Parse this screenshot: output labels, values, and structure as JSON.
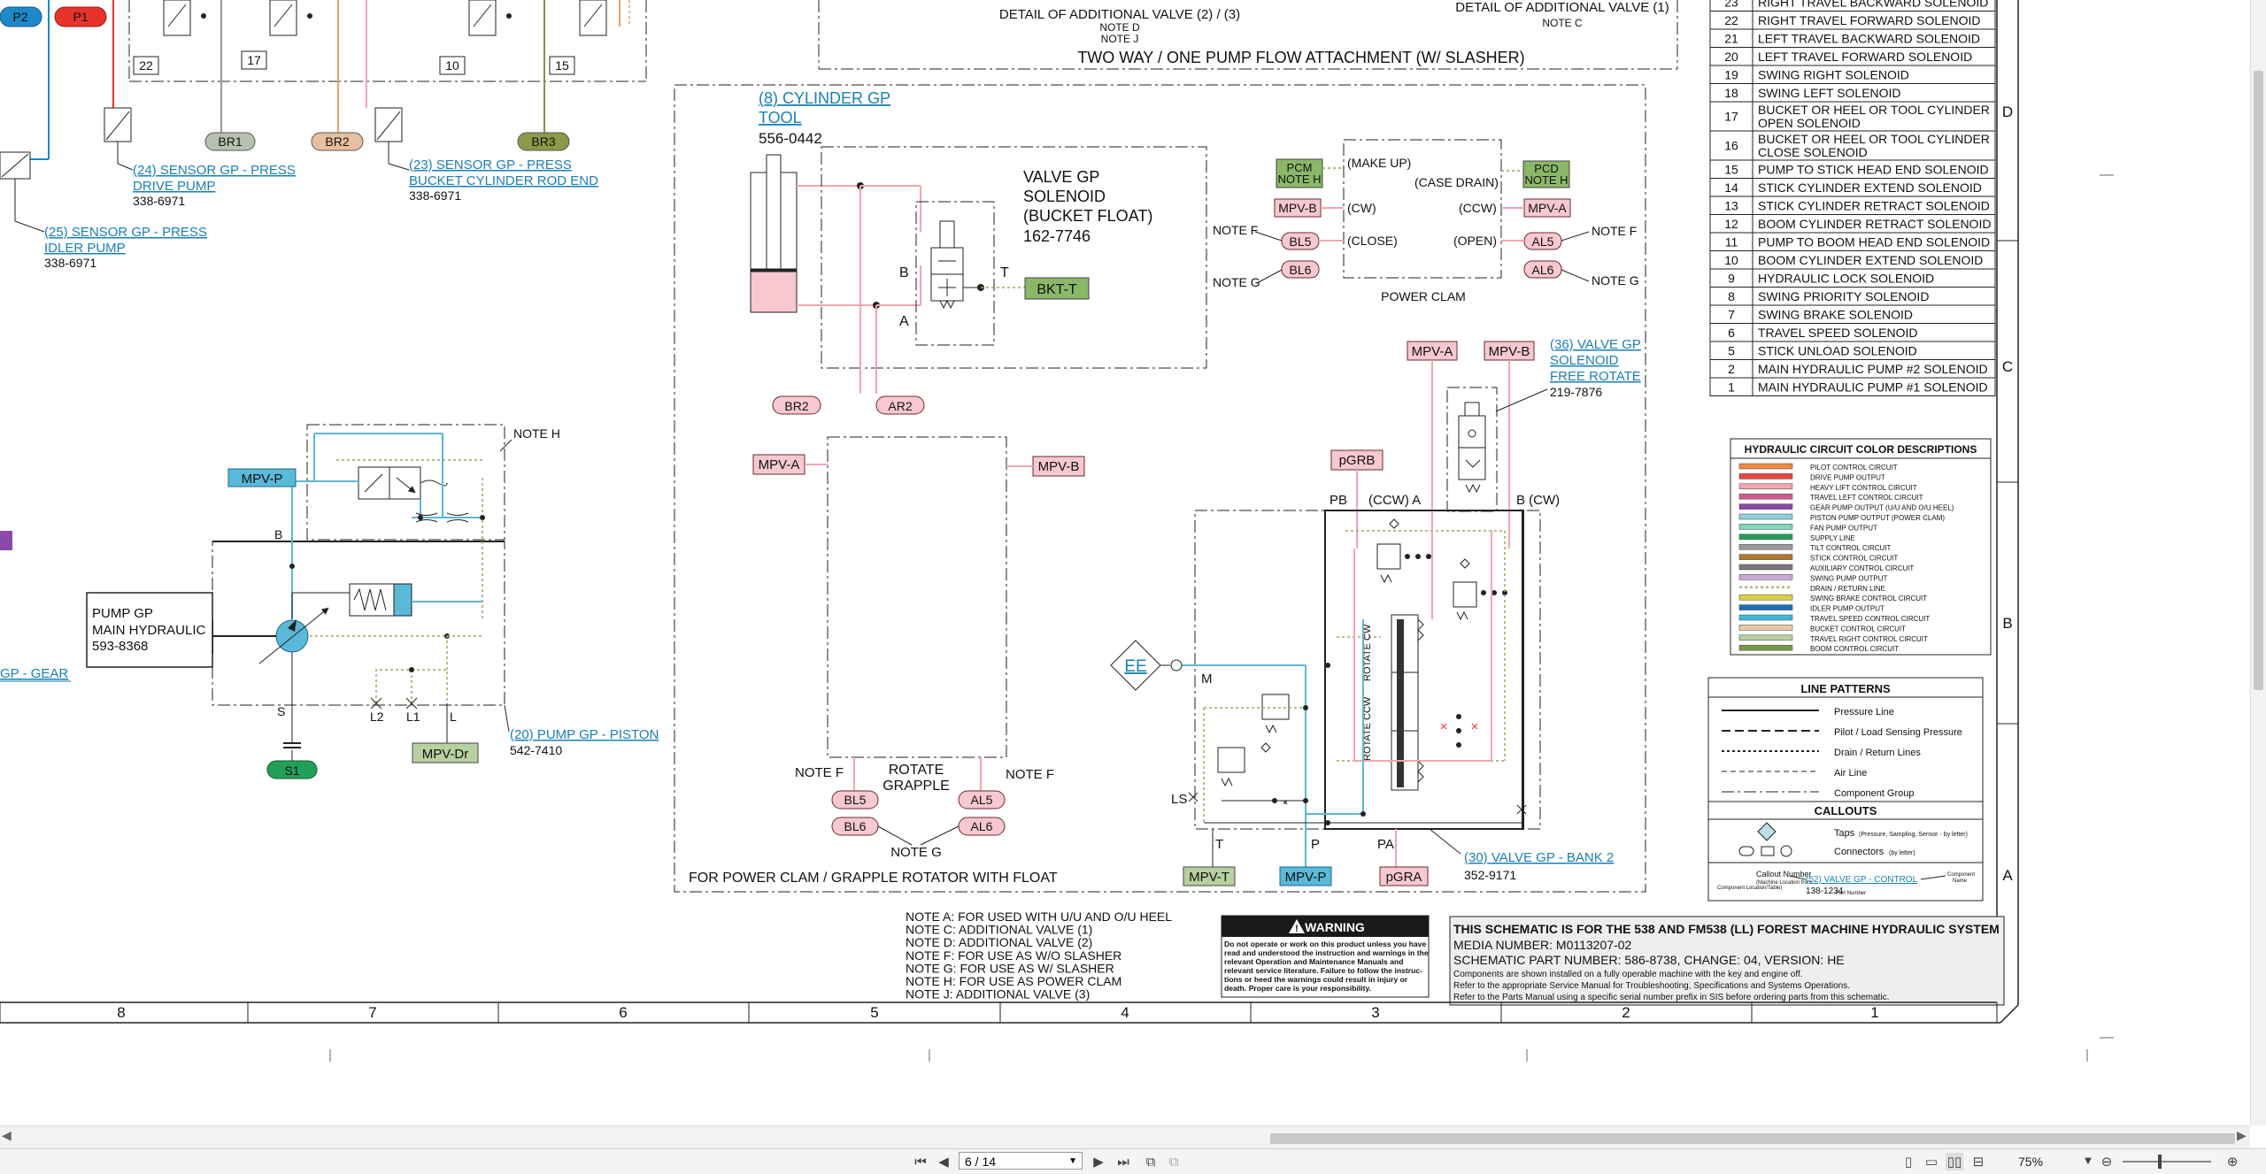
{
  "viewer": {
    "page_display": "6 / 14",
    "zoom": "75%",
    "nav": {
      "first": "⏮",
      "prev": "◀",
      "next": "▶",
      "last": "⏭"
    }
  },
  "top": {
    "p2": "P2",
    "p1": "P1",
    "detail_left": "DETAIL OF ADDITIONAL VALVE (2) / (3)",
    "detail_left_notes": [
      "NOTE D",
      "NOTE J"
    ],
    "detail_right": "DETAIL OF ADDITIONAL VALVE (1)",
    "detail_right_note": "NOTE C",
    "two_way_title": "TWO WAY / ONE PUMP FLOW  ATTACHMENT (W/ SLASHER)",
    "box_numbers": [
      "22",
      "17",
      "10",
      "15"
    ],
    "br_tags": [
      "BR1",
      "BR2",
      "BR3"
    ]
  },
  "sensors": [
    {
      "label": "(24) SENSOR GP - PRESS",
      "label2": "DRIVE PUMP",
      "part": "338-6971"
    },
    {
      "label": "(23) SENSOR GP - PRESS",
      "label2": "BUCKET CYLINDER ROD END",
      "part": "338-6971"
    },
    {
      "label": "(25) SENSOR GP - PRESS",
      "label2": "IDLER PUMP",
      "part": "338-6971"
    }
  ],
  "pump": {
    "title1": "PUMP GP",
    "title2": "MAIN HYDRAULIC",
    "part": "593-8368",
    "mpv_p": "MPV-P",
    "note_h": "NOTE H",
    "b": "B",
    "s": "S",
    "s1": "S1",
    "l2": "L2",
    "l1": "L1",
    "l": "L",
    "mpv_dr": "MPV-Dr",
    "piston_link": "(20) PUMP GP - PISTON",
    "piston_part": "542-7410",
    "gear_link": "GP - GEAR"
  },
  "attachment": {
    "cyl_link1": "(8) CYLINDER GP",
    "cyl_link2": "TOOL",
    "cyl_part": "556-0442",
    "valve1": "VALVE GP",
    "valve2": "SOLENOID",
    "valve3": "(BUCKET FLOAT)",
    "valve_part": "162-7746",
    "b": "B",
    "a": "A",
    "t": "T",
    "bkt": "BKT-T",
    "br2": "BR2",
    "ar2": "AR2",
    "mpv_a": "MPV-A",
    "mpv_b": "MPV-B",
    "rotate": "ROTATE",
    "grapple": "GRAPPLE",
    "note_f": "NOTE F",
    "note_g": "NOTE G",
    "bl5": "BL5",
    "bl6": "BL6",
    "al5": "AL5",
    "al6": "AL6",
    "footer": "FOR POWER CLAM / GRAPPLE ROTATOR WITH FLOAT"
  },
  "power_clam": {
    "pcm": "PCM",
    "pcm_note": "NOTE H",
    "pcd": "PCD",
    "pcd_note": "NOTE H",
    "make_up": "(MAKE UP)",
    "case_drain": "(CASE DRAIN)",
    "cw": "(CW)",
    "ccw": "(CCW)",
    "close": "(CLOSE)",
    "open": "(OPEN)",
    "mpv_b": "MPV-B",
    "mpv_a": "MPV-A",
    "bl5": "BL5",
    "bl6": "BL6",
    "al5": "AL5",
    "al6": "AL6",
    "note_f": "NOTE F",
    "note_g": "NOTE G",
    "title": "POWER CLAM"
  },
  "rotate_valve": {
    "mpv_a": "MPV-A",
    "mpv_b": "MPV-B",
    "link1": "(36) VALVE GP",
    "link2": "SOLENOID",
    "link3": "FREE ROTATE",
    "part": "219-7876",
    "pgrb": "pGRB",
    "pb": "PB",
    "ccw_a": "(CCW) A",
    "b_cw": "B (CW)",
    "ee": "EE",
    "m": "M",
    "ls": "LS",
    "t": "T",
    "p": "P",
    "pa": "PA",
    "rotate_cw": "ROTATE CW",
    "rotate_ccw": "ROTATE CCW",
    "mpv_t": "MPV-T",
    "mpv_p": "MPV-P",
    "pgra": "pGRA",
    "bank_link": "(30) VALVE GP - BANK 2",
    "bank_part": "352-9171"
  },
  "solenoids": [
    {
      "n": "23",
      "d": "RIGHT TRAVEL BACKWARD SOLENOID"
    },
    {
      "n": "22",
      "d": "RIGHT TRAVEL FORWARD SOLENOID"
    },
    {
      "n": "21",
      "d": "LEFT TRAVEL BACKWARD SOLENOID"
    },
    {
      "n": "20",
      "d": "LEFT TRAVEL FORWARD SOLENOID"
    },
    {
      "n": "19",
      "d": "SWING RIGHT SOLENOID"
    },
    {
      "n": "18",
      "d": "SWING LEFT SOLENOID"
    },
    {
      "n": "17",
      "d": "BUCKET OR HEEL OR TOOL CYLINDER",
      "d2": "OPEN SOLENOID"
    },
    {
      "n": "16",
      "d": "BUCKET OR HEEL OR TOOL CYLINDER",
      "d2": "CLOSE SOLENOID"
    },
    {
      "n": "15",
      "d": "PUMP TO STICK HEAD END SOLENOID"
    },
    {
      "n": "14",
      "d": "STICK CYLINDER EXTEND SOLENOID"
    },
    {
      "n": "13",
      "d": "STICK CYLINDER RETRACT SOLENOID"
    },
    {
      "n": "12",
      "d": "BOOM CYLINDER RETRACT SOLENOID"
    },
    {
      "n": "11",
      "d": "PUMP TO BOOM HEAD END SOLENOID"
    },
    {
      "n": "10",
      "d": "BOOM CYLINDER EXTEND SOLENOID"
    },
    {
      "n": "9",
      "d": "HYDRAULIC LOCK SOLENOID"
    },
    {
      "n": "8",
      "d": "SWING PRIORITY SOLENOID"
    },
    {
      "n": "7",
      "d": "SWING BRAKE SOLENOID"
    },
    {
      "n": "6",
      "d": "TRAVEL SPEED SOLENOID"
    },
    {
      "n": "5",
      "d": "STICK UNLOAD SOLENOID"
    },
    {
      "n": "2",
      "d": "MAIN HYDRAULIC PUMP #2 SOLENOID"
    },
    {
      "n": "1",
      "d": "MAIN HYDRAULIC PUMP #1 SOLENOID"
    }
  ],
  "row_letters": [
    "D",
    "C",
    "B",
    "A"
  ],
  "color_desc": {
    "title": "HYDRAULIC CIRCUIT COLOR DESCRIPTIONS",
    "items": [
      {
        "c": "#f08a3c",
        "t": "PILOT CONTROL CIRCUIT"
      },
      {
        "c": "#e8453c",
        "t": "DRIVE PUMP OUTPUT"
      },
      {
        "c": "#f2a6b0",
        "t": "HEAVY LIFT CONTROL CIRCUIT"
      },
      {
        "c": "#d05a8c",
        "t": "TRAVEL LEFT CONTROL CIRCUIT"
      },
      {
        "c": "#8a4aa8",
        "t": "GEAR PUMP OUTPUT (U/U AND O/U HEEL)"
      },
      {
        "c": "#8fd0e0",
        "t": "PISTON PUMP OUTPUT (POWER CLAM)"
      },
      {
        "c": "#7fd6b8",
        "t": "FAN PUMP OUTPUT"
      },
      {
        "c": "#22a05a",
        "t": "SUPPLY LINE"
      },
      {
        "c": "#9a9a9a",
        "t": "TILT CONTROL CIRCUIT"
      },
      {
        "c": "#b07830",
        "t": "STICK CONTROL CIRCUIT"
      },
      {
        "c": "#7a7a7a",
        "t": "AUXILIARY CONTROL CIRCUIT"
      },
      {
        "c": "#c8a8d8",
        "t": "SWING PUMP OUTPUT"
      },
      {
        "c": "#a8a060",
        "t": "DRAIN / RETURN LINE"
      },
      {
        "c": "#d8d040",
        "t": "SWING BRAKE CONTROL CIRCUIT"
      },
      {
        "c": "#1e6fb8",
        "t": "IDLER PUMP OUTPUT"
      },
      {
        "c": "#3cb8d8",
        "t": "TRAVEL SPEED CONTROL CIRCUIT"
      },
      {
        "c": "#e8c8a8",
        "t": "BUCKET CONTROL CIRCUIT"
      },
      {
        "c": "#b8d0a8",
        "t": "TRAVEL RIGHT CONTROL CIRCUIT"
      },
      {
        "c": "#7a9a48",
        "t": "BOOM CONTROL CIRCUIT"
      }
    ]
  },
  "line_patterns": {
    "title": "LINE PATTERNS",
    "items": [
      "Pressure Line",
      "Pilot / Load Sensing Pressure",
      "Drain / Return Lines",
      "Air Line",
      "Component Group"
    ],
    "callouts_title": "CALLOUTS",
    "taps": "Taps",
    "taps_small": "(Pressure, Sampling, Sensor - by letter)",
    "connectors": "Connectors",
    "connectors_small": "(by letter)",
    "cn_label1": "Callout Number",
    "cn_label2": "(Machine Location from",
    "cn_label3": "Component Location/Table)",
    "sample_link": "(52) VALVE GP - CONTROL",
    "sample_part": "138-1234",
    "comp_name": "Component",
    "comp_name2": "Name",
    "part_number": "Part Number"
  },
  "notes": [
    "NOTE A: FOR USED WITH U/U AND O/U HEEL",
    "NOTE C: ADDITIONAL VALVE (1)",
    "NOTE D: ADDITIONAL VALVE (2)",
    "NOTE F: FOR USE AS W/O SLASHER",
    "NOTE G: FOR USE AS W/ SLASHER",
    "NOTE H: FOR USE AS POWER CLAM",
    "NOTE J: ADDITIONAL VALVE (3)"
  ],
  "warning": {
    "title": "WARNING",
    "lines": [
      "Do not operate or work on this product unless you have",
      "read and understood the instruction and warnings in the",
      "relevant Operation and Maintenance Manuals and",
      "relevant service literature. Failure to follow the instruc-",
      "tions or heed the warnings could result in injury or",
      "death. Proper care is your responsibility."
    ]
  },
  "title_block": {
    "title": "THIS SCHEMATIC IS FOR THE 538 AND FM538 (LL) FOREST MACHINE HYDRAULIC SYSTEM",
    "media": "MEDIA NUMBER: M0113207-02",
    "part": "SCHEMATIC PART NUMBER: 586-8738, CHANGE: 04, VERSION: HE",
    "l1": "Components are shown installed on a fully operable machine with the key and engine off.",
    "l2": "Refer to the appropriate Service Manual for Troubleshooting, Specifications and Systems Operations.",
    "l3": "Refer to the Parts Manual using a specific serial number prefix in SIS before ordering parts from this schematic."
  },
  "col_numbers": [
    "8",
    "7",
    "6",
    "5",
    "4",
    "3",
    "2",
    "1"
  ]
}
